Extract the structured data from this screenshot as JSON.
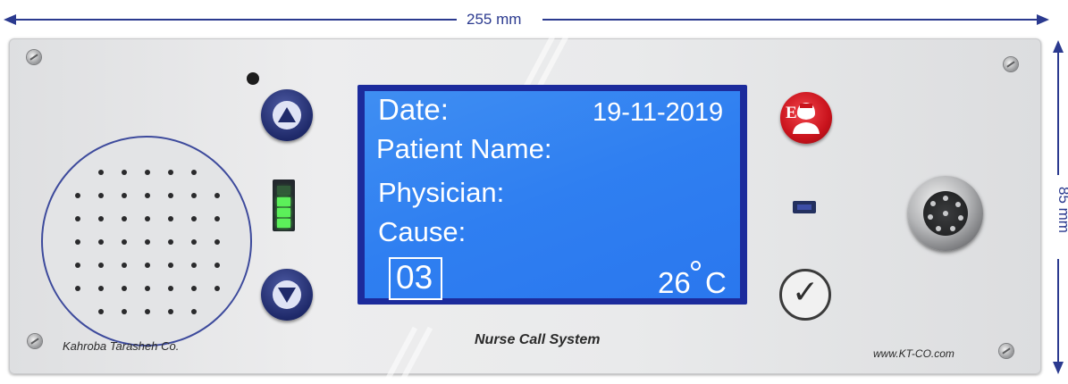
{
  "dimensions": {
    "width_label": "255 mm",
    "height_label": "85 mm"
  },
  "device": {
    "company": "Kahroba Tarasheh Co.",
    "system_name": "Nurse Call System",
    "website": "www.KT-CO.com"
  },
  "display": {
    "date_label": "Date:",
    "date_value": "19-11-2019",
    "patient_label": "Patient Name:",
    "physician_label": "Physician:",
    "cause_label": "Cause:",
    "room_number": "03",
    "temperature": "26",
    "temp_unit": "C"
  },
  "buttons": {
    "emergency_letter": "E",
    "confirm_symbol": "✓"
  },
  "colors": {
    "lcd_background": "#2f7ff1",
    "navy_button": "#1f2a6a",
    "emergency_red": "#d11a22",
    "indicator_green": "#5cf05a",
    "dimension_blue": "#2b3a8f"
  }
}
